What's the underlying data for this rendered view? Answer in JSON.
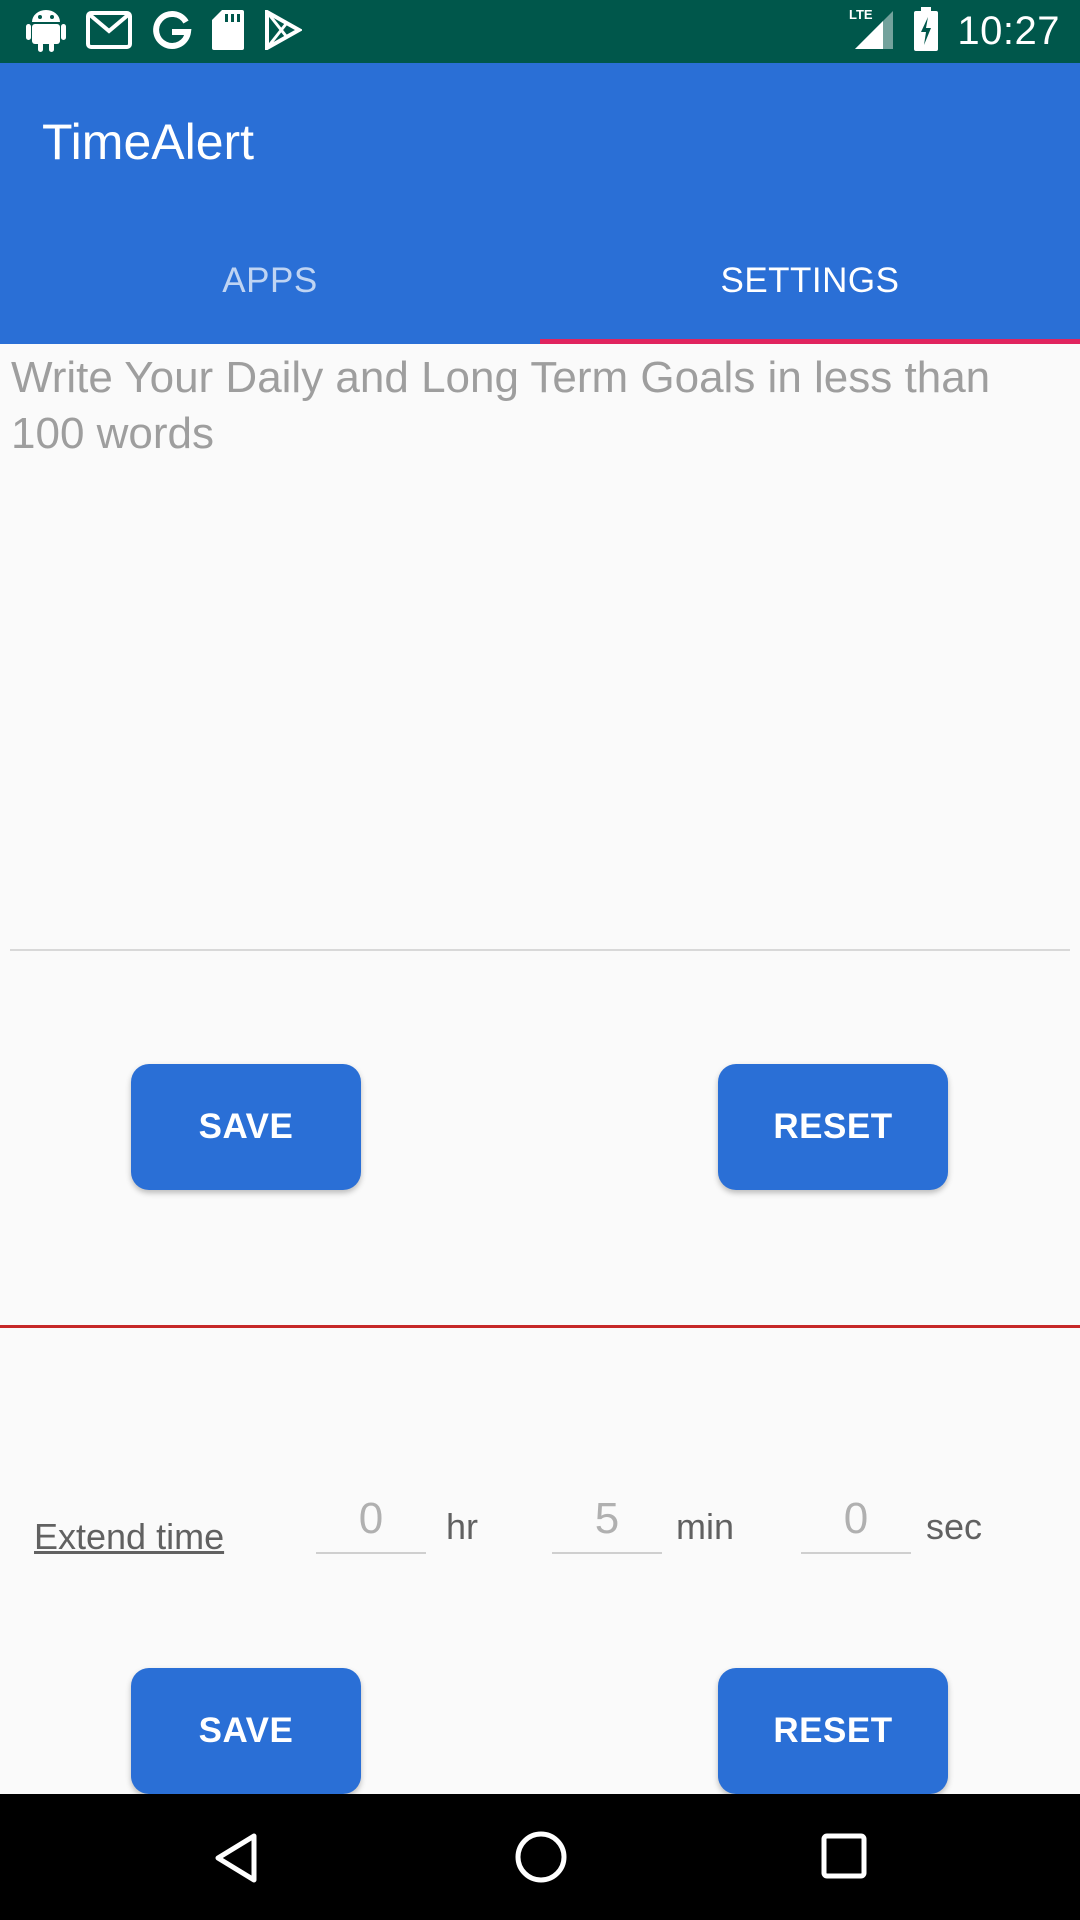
{
  "status_bar": {
    "time": "10:27",
    "network": "LTE",
    "left_icons": [
      "android-icon",
      "gmail-icon",
      "google-icon",
      "sd-card-icon",
      "play-store-icon"
    ],
    "right_icons": [
      "signal-icon",
      "battery-charging-icon"
    ]
  },
  "app": {
    "title": "TimeAlert",
    "accent_color": "#2a6fd6",
    "tab_indicator_color": "#e0245e"
  },
  "tabs": [
    {
      "label": "APPS",
      "active": false
    },
    {
      "label": "SETTINGS",
      "active": true
    }
  ],
  "goals": {
    "placeholder": "Write Your Daily and Long Term Goals in less than 100 words",
    "value": ""
  },
  "goals_actions": {
    "save_label": "SAVE",
    "reset_label": "RESET"
  },
  "extend": {
    "label": "Extend time",
    "hours": {
      "value": "0",
      "unit": "hr"
    },
    "minutes": {
      "value": "5",
      "unit": "min"
    },
    "seconds": {
      "value": "0",
      "unit": "sec"
    }
  },
  "extend_actions": {
    "save_label": "SAVE",
    "reset_label": "RESET"
  },
  "nav": [
    "back-icon",
    "home-icon",
    "recents-icon"
  ]
}
